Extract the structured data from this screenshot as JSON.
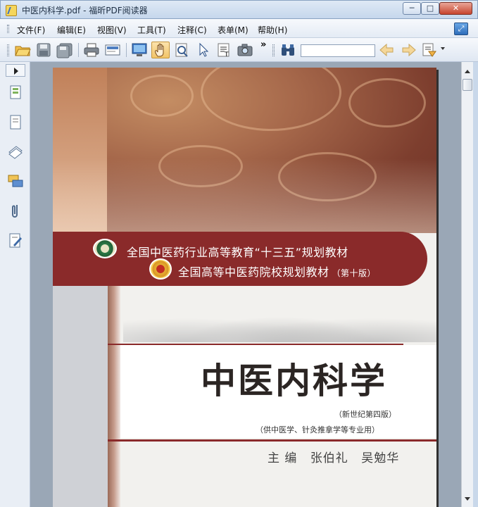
{
  "window": {
    "title": "中医内科学.pdf - 福昕PDF阅读器",
    "controls": {
      "minimize": "─",
      "maximize": "□",
      "close": "✕"
    }
  },
  "menu": {
    "items": [
      "文件(F)",
      "编辑(E)",
      "视图(V)",
      "工具(T)",
      "注释(C)",
      "表单(M)",
      "帮助(H)"
    ]
  },
  "toolbar": {
    "overflow": "»",
    "search_value": "",
    "buttons": [
      "open-icon",
      "save-icon",
      "save-as-icon",
      "print-icon",
      "email-icon",
      "fullscreen-icon",
      "hand-tool-icon",
      "zoom-tool-icon",
      "select-tool-icon",
      "text-select-icon",
      "snapshot-icon",
      "find-icon",
      "prev-result-icon",
      "next-result-icon",
      "highlight-icon"
    ],
    "active_tool": "hand-tool-icon"
  },
  "sidebar": {
    "buttons": [
      "pages-panel-icon",
      "layers-panel-icon",
      "bookmarks-panel-icon",
      "comments-panel-icon",
      "attachments-panel-icon",
      "signatures-panel-icon"
    ]
  },
  "document": {
    "band_line1": "全国中医药行业高等教育“十三五”规划教材",
    "band_line2": "全国高等中医药院校规划教材",
    "band_edition": "（第十版）",
    "title": "中医内科学",
    "subtitle1": "（新世纪第四版）",
    "subtitle2": "（供中医学、针灸推拿学等专业用）",
    "authors_label": "主 编",
    "author1": "张伯礼",
    "author2": "吴勉华"
  },
  "colors": {
    "band": "#8a2a2a",
    "cover_top": "#7d3e2e",
    "titlebar": "#c6d7ec"
  }
}
